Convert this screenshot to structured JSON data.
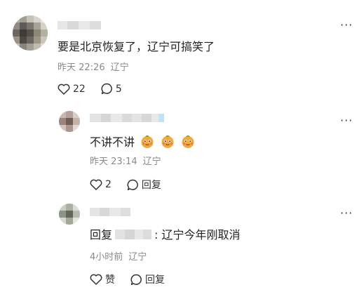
{
  "menu_glyph": "···",
  "comments": [
    {
      "text": "要是北京恢复了，辽宁可搞笑了",
      "time": "昨天 22:26",
      "location": "辽宁",
      "likes": "22",
      "replies": "5"
    },
    {
      "text": "不讲不讲",
      "time": "昨天 23:14",
      "location": "辽宁",
      "likes": "2",
      "reply_label": "回复"
    },
    {
      "reply_prefix": "回复",
      "text": ": 辽宁今年刚取消",
      "time": "4小时前",
      "location": "辽宁",
      "likes_label": "赞",
      "reply_label": "回复"
    }
  ],
  "icons": {
    "heart": "heart-outline-icon",
    "bubble": "comment-bubble-icon",
    "more": "more-dots-icon",
    "emoji": "orange-smiley-emoji"
  }
}
